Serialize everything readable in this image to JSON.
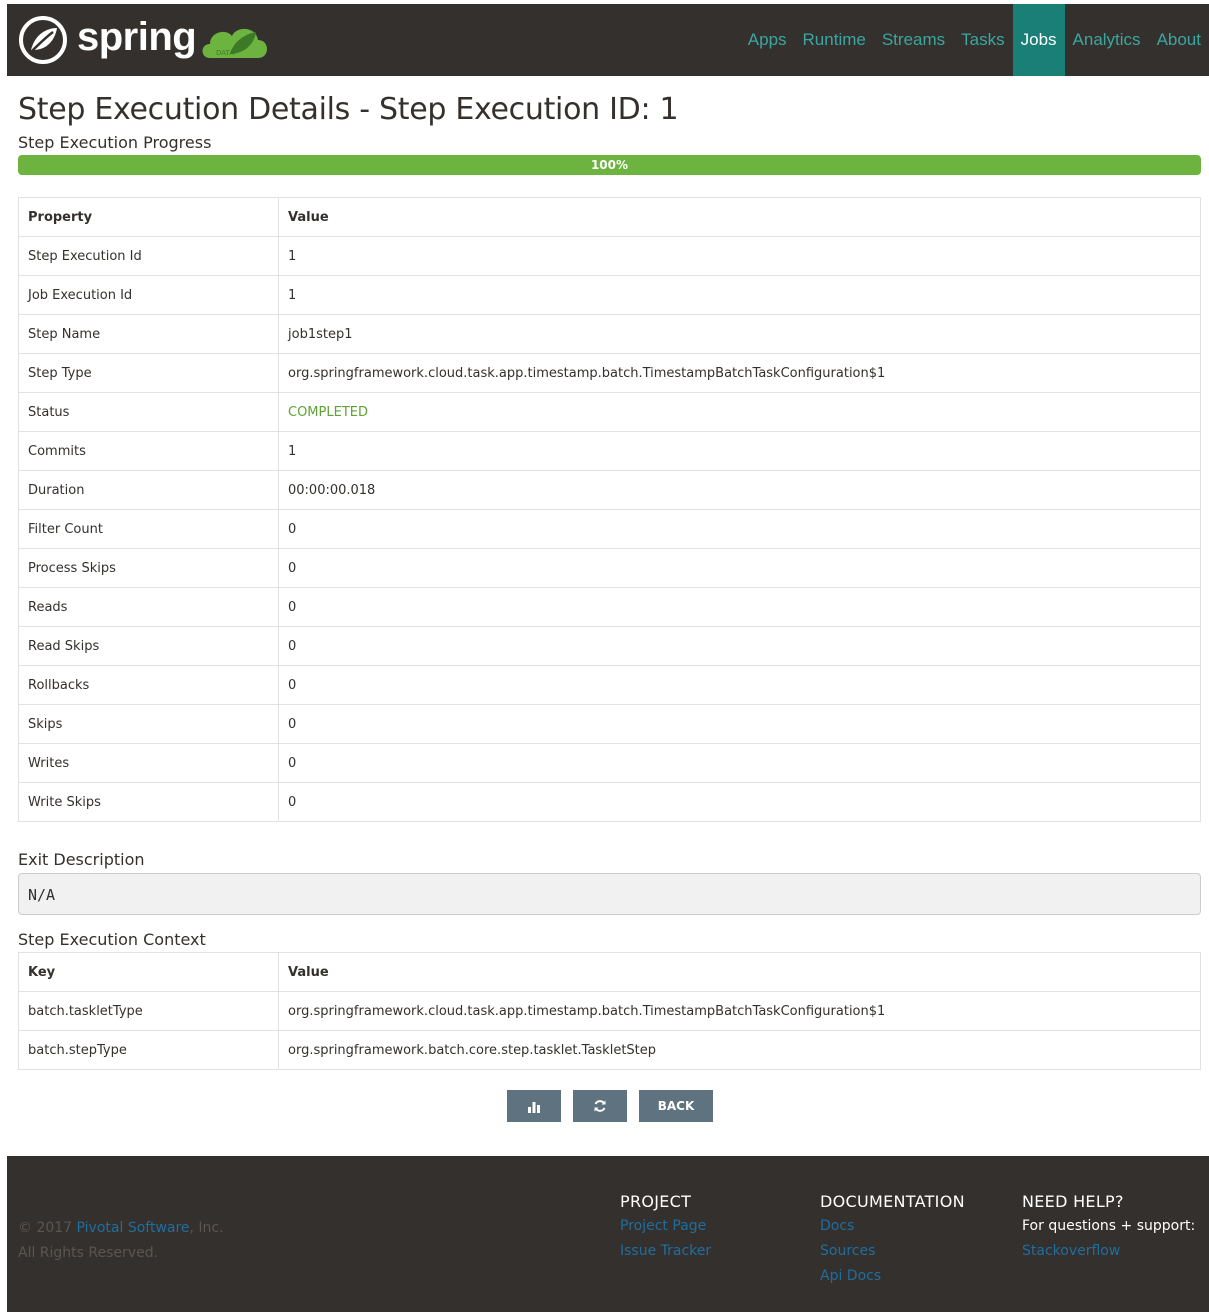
{
  "header": {
    "logo_text": "spring",
    "nav": [
      {
        "label": "Apps",
        "active": false
      },
      {
        "label": "Runtime",
        "active": false
      },
      {
        "label": "Streams",
        "active": false
      },
      {
        "label": "Tasks",
        "active": false
      },
      {
        "label": "Jobs",
        "active": true
      },
      {
        "label": "Analytics",
        "active": false
      },
      {
        "label": "About",
        "active": false
      }
    ]
  },
  "page": {
    "title": "Step Execution Details - Step Execution ID: 1",
    "progress_label": "Step Execution Progress",
    "progress_value": 100,
    "progress_text": "100%"
  },
  "properties": {
    "headers": [
      "Property",
      "Value"
    ],
    "rows": [
      {
        "name": "Step Execution Id",
        "value": "1"
      },
      {
        "name": "Job Execution Id",
        "value": "1"
      },
      {
        "name": "Step Name",
        "value": "job1step1"
      },
      {
        "name": "Step Type",
        "value": "org.springframework.cloud.task.app.timestamp.batch.TimestampBatchTaskConfiguration$1"
      },
      {
        "name": "Status",
        "value": "COMPLETED"
      },
      {
        "name": "Commits",
        "value": "1"
      },
      {
        "name": "Duration",
        "value": "00:00:00.018"
      },
      {
        "name": "Filter Count",
        "value": "0"
      },
      {
        "name": "Process Skips",
        "value": "0"
      },
      {
        "name": "Reads",
        "value": "0"
      },
      {
        "name": "Read Skips",
        "value": "0"
      },
      {
        "name": "Rollbacks",
        "value": "0"
      },
      {
        "name": "Skips",
        "value": "0"
      },
      {
        "name": "Writes",
        "value": "0"
      },
      {
        "name": "Write Skips",
        "value": "0"
      }
    ]
  },
  "exit": {
    "label": "Exit Description",
    "value": "N/A"
  },
  "context": {
    "label": "Step Execution Context",
    "headers": [
      "Key",
      "Value"
    ],
    "rows": [
      {
        "key": "batch.taskletType",
        "value": "org.springframework.cloud.task.app.timestamp.batch.TimestampBatchTaskConfiguration$1"
      },
      {
        "key": "batch.stepType",
        "value": "org.springframework.batch.core.step.tasklet.TaskletStep"
      }
    ]
  },
  "actions": {
    "chart_icon": "bar-chart-icon",
    "refresh_icon": "refresh-icon",
    "back_label": "BACK"
  },
  "footer": {
    "copyright_prefix": "© 2017 ",
    "company_link": "Pivotal Software",
    "copyright_suffix": ", Inc.",
    "rights": "All Rights Reserved.",
    "project": {
      "heading": "PROJECT",
      "links": [
        "Project Page",
        "Issue Tracker"
      ]
    },
    "documentation": {
      "heading": "DOCUMENTATION",
      "links": [
        "Docs",
        "Sources",
        "Api Docs"
      ]
    },
    "help": {
      "heading": "NEED HELP?",
      "text": "For questions + support:",
      "link": "Stackoverflow"
    }
  }
}
